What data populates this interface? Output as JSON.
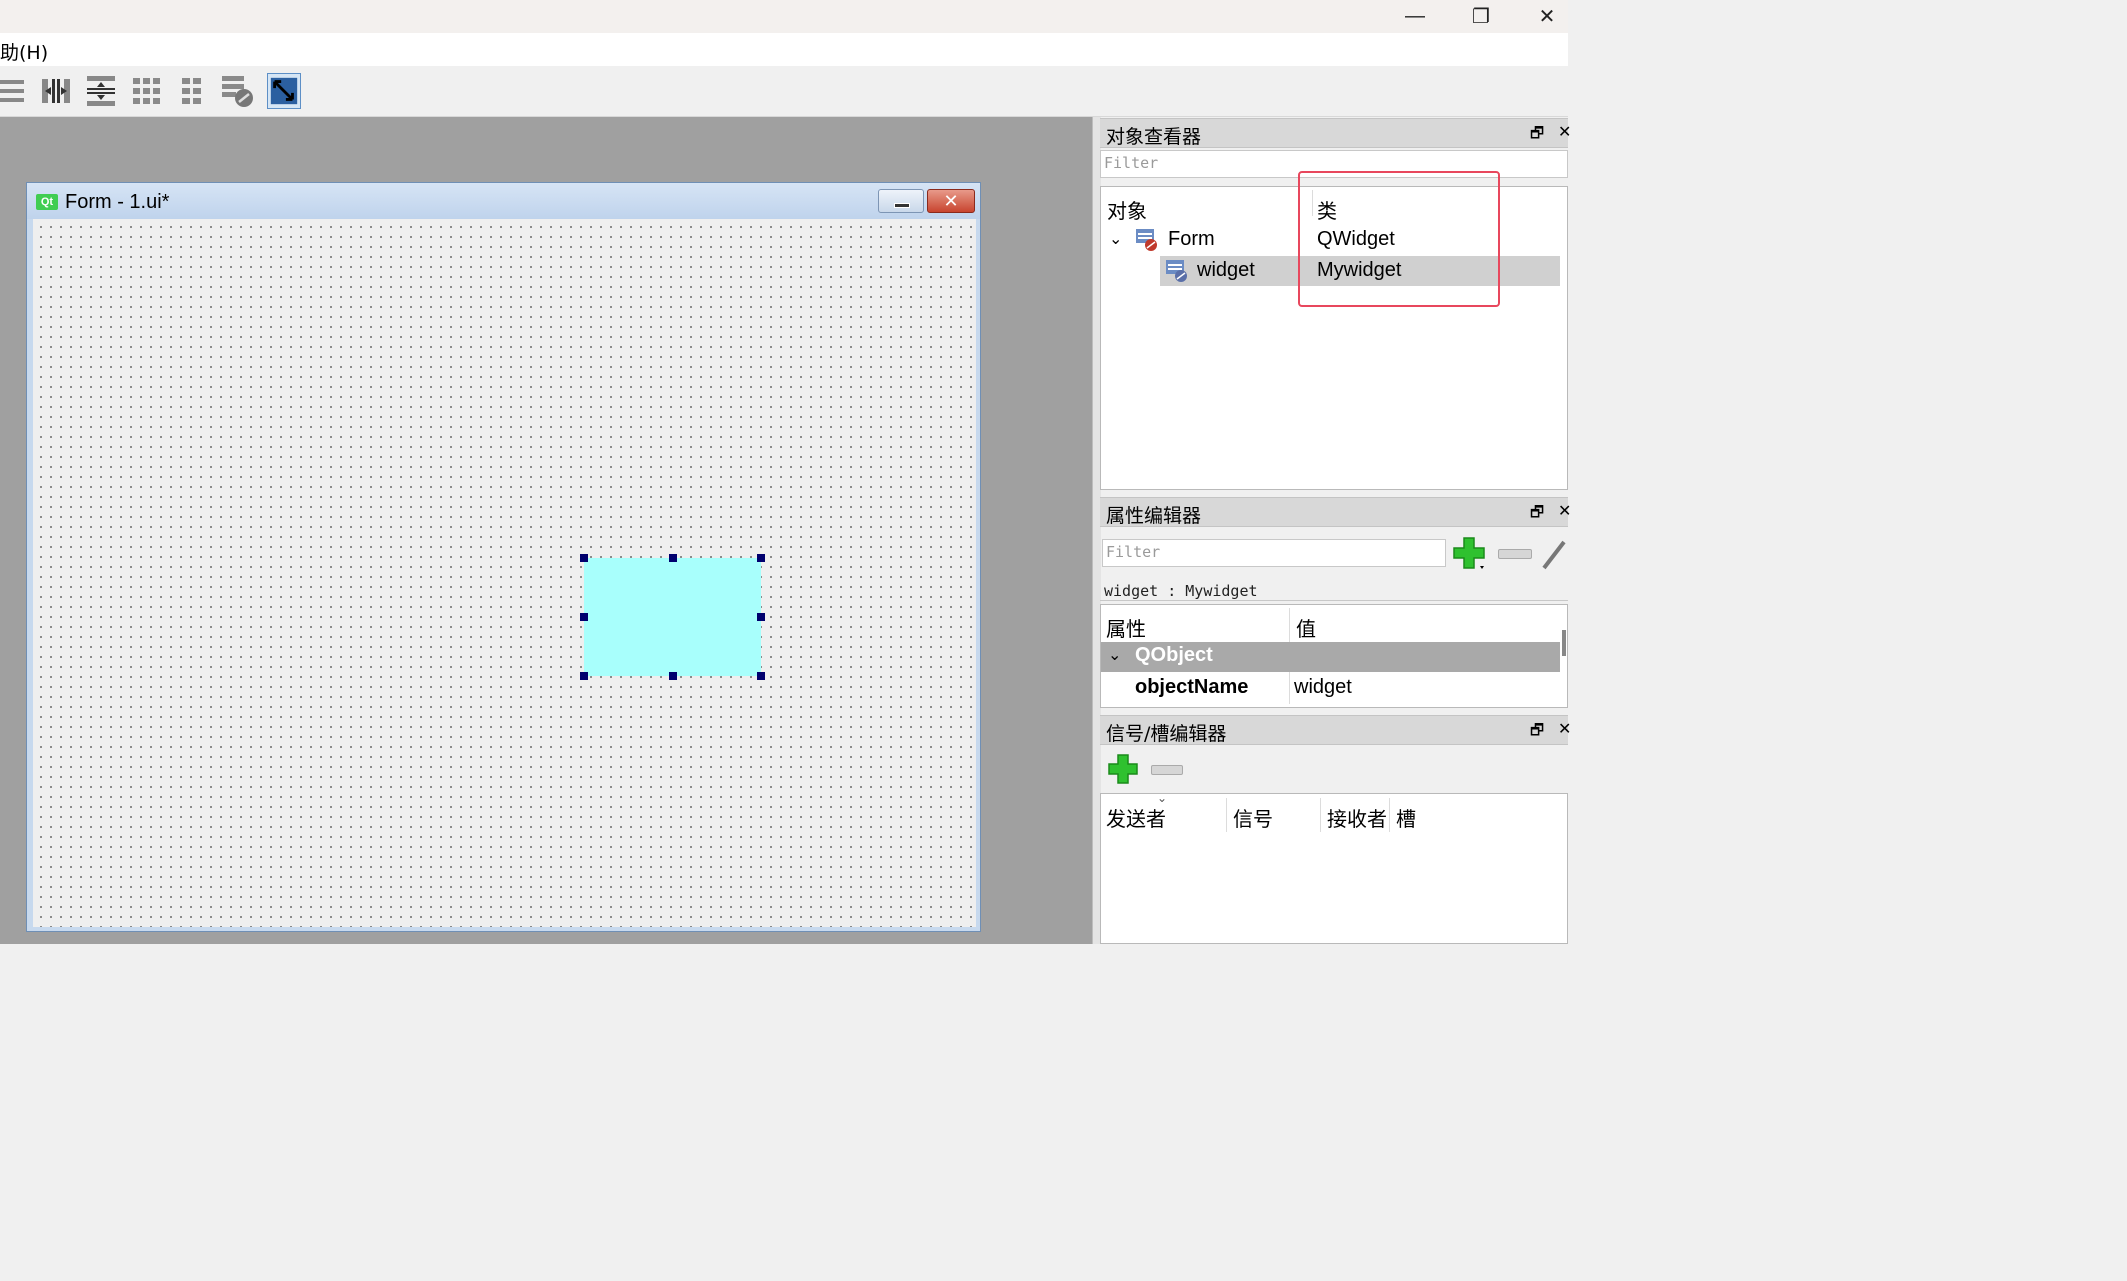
{
  "window_controls": {
    "minimize": "—",
    "restore": "❐",
    "close": "✕"
  },
  "menu": {
    "help": "助(H)"
  },
  "toolbar": {
    "buttons": [
      "layout-vertical-icon",
      "layout-horizontal-splitter-icon",
      "layout-vertical-splitter-icon",
      "layout-grid-icon",
      "layout-form-icon",
      "break-layout-icon",
      "adjust-size-icon"
    ]
  },
  "form_window": {
    "logo": "Qt",
    "title": "Form - 1.ui*",
    "close_symbol": "✕"
  },
  "object_inspector": {
    "title": "对象查看器",
    "filter_placeholder": "Filter",
    "col_object": "对象",
    "col_class": "类",
    "rows": [
      {
        "object": "Form",
        "class": "QWidget"
      },
      {
        "object": "widget",
        "class": "Mywidget"
      }
    ]
  },
  "property_editor": {
    "title": "属性编辑器",
    "filter_placeholder": "Filter",
    "context": "widget : Mywidget",
    "col_property": "属性",
    "col_value": "值",
    "group": "QObject",
    "prop_name": "objectName",
    "prop_value": "widget"
  },
  "signal_slot_editor": {
    "title": "信号/槽编辑器",
    "col_sender": "发送者",
    "col_signal": "信号",
    "col_receiver": "接收者",
    "col_slot": "槽"
  },
  "dock_float_symbol": "🗗",
  "dock_close_symbol": "✕",
  "colors": {
    "highlight": "#e8475d",
    "widget_fill": "#a8fffc",
    "selection": "#d0d0d0"
  }
}
